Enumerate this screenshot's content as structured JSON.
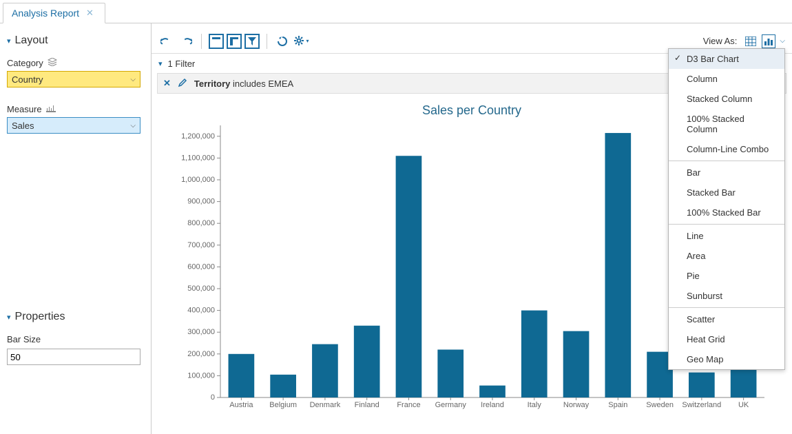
{
  "tab": {
    "title": "Analysis Report"
  },
  "sidebar": {
    "layout_label": "Layout",
    "category_label": "Category",
    "category_value": "Country",
    "measure_label": "Measure",
    "measure_value": "Sales",
    "properties_label": "Properties",
    "bar_size_label": "Bar Size",
    "bar_size_value": "50"
  },
  "toolbar": {
    "view_as_label": "View As:"
  },
  "filter": {
    "summary": "1 Filter",
    "field": "Territory",
    "op": "includes",
    "value": "EMEA"
  },
  "dropdown": {
    "selected": "D3 Bar Chart",
    "groups": [
      [
        "D3 Bar Chart",
        "Column",
        "Stacked Column",
        "100% Stacked Column",
        "Column-Line Combo"
      ],
      [
        "Bar",
        "Stacked Bar",
        "100% Stacked Bar"
      ],
      [
        "Line",
        "Area",
        "Pie",
        "Sunburst"
      ],
      [
        "Scatter",
        "Heat Grid",
        "Geo Map"
      ]
    ]
  },
  "chart_data": {
    "type": "bar",
    "title": "Sales per Country",
    "xlabel": "",
    "ylabel": "",
    "categories": [
      "Austria",
      "Belgium",
      "Denmark",
      "Finland",
      "France",
      "Germany",
      "Ireland",
      "Italy",
      "Norway",
      "Spain",
      "Sweden",
      "Switzerland",
      "UK"
    ],
    "values": [
      200000,
      105000,
      245000,
      330000,
      1110000,
      220000,
      55000,
      400000,
      305000,
      1215000,
      210000,
      115000,
      320000
    ],
    "ylim": [
      0,
      1250000
    ],
    "yticks": [
      0,
      100000,
      200000,
      300000,
      400000,
      500000,
      600000,
      700000,
      800000,
      900000,
      1000000,
      1100000,
      1200000
    ]
  }
}
